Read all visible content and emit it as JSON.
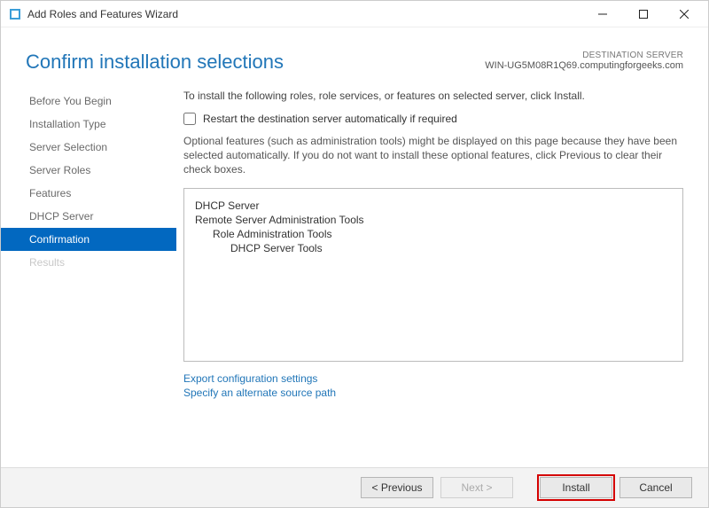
{
  "window": {
    "title": "Add Roles and Features Wizard"
  },
  "header": {
    "title": "Confirm installation selections",
    "dest_label": "DESTINATION SERVER",
    "dest_value": "WIN-UG5M08R1Q69.computingforgeeks.com"
  },
  "sidebar": {
    "items": [
      {
        "label": "Before You Begin"
      },
      {
        "label": "Installation Type"
      },
      {
        "label": "Server Selection"
      },
      {
        "label": "Server Roles"
      },
      {
        "label": "Features"
      },
      {
        "label": "DHCP Server"
      },
      {
        "label": "Confirmation"
      },
      {
        "label": "Results"
      }
    ]
  },
  "content": {
    "instruction": "To install the following roles, role services, or features on selected server, click Install.",
    "restart_label": "Restart the destination server automatically if required",
    "optional_note": "Optional features (such as administration tools) might be displayed on this page because they have been selected automatically. If you do not want to install these optional features, click Previous to clear their check boxes.",
    "selections": {
      "l0a": "DHCP Server",
      "l0b": "Remote Server Administration Tools",
      "l1a": "Role Administration Tools",
      "l2a": "DHCP Server Tools"
    },
    "link_export": "Export configuration settings",
    "link_source": "Specify an alternate source path"
  },
  "footer": {
    "previous": "< Previous",
    "next": "Next >",
    "install": "Install",
    "cancel": "Cancel"
  }
}
